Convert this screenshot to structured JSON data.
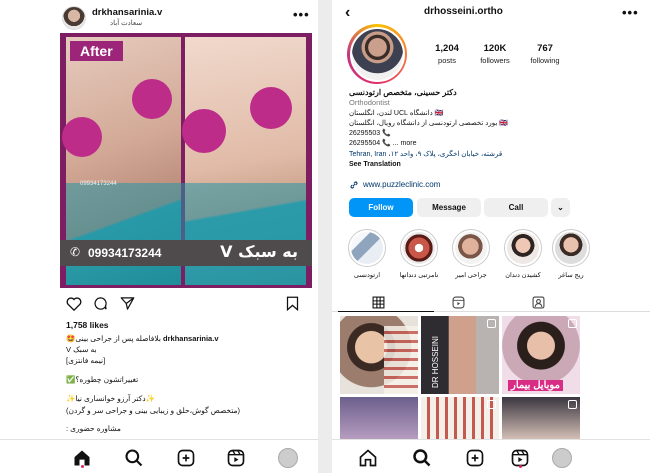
{
  "post": {
    "username": "drkhansarinia.v",
    "subtitle": "سعادت آباد",
    "image": {
      "badge": "After",
      "watermark": "09934173244",
      "phone": "09934173244",
      "style_text": "به سبک V"
    },
    "likes": "1,758 likes",
    "caption_user": "drkhansarinia.v",
    "caption_text": "بلافاصله پس از جراحی بینی🤩",
    "caption_lines": [
      "به سبک V",
      "[نیمه فانتزی]",
      "تغییراتشون چطوره؟✅",
      "✨دکتر آرزو خوانساری نیا✨",
      "(متخصص گوش،حلق و زیبایی بینی و جراحی سر و گردن)",
      "مشاوره حضوری :"
    ]
  },
  "profile": {
    "username": "drhosseini.ortho",
    "stats": [
      {
        "value": "1,204",
        "label": "posts"
      },
      {
        "value": "120K",
        "label": "followers"
      },
      {
        "value": "767",
        "label": "following"
      }
    ],
    "name": "دکتر حسینی، متخصص ارتودنسی",
    "category": "Orthodontist",
    "bio_lines": [
      "🇬🇧 دانشگاه UCL لندن، انگلستان",
      "🇬🇧 بورد تخصصی ارتودنسی از دانشگاه رویال، انگلستان",
      "26295503 📞",
      "26295504 📞 ... more"
    ],
    "address": "Tehran, Iran ،قرشته، خیابان اخگری، پلاک ۹، واحد ۱۲",
    "see_translation": "See Translation",
    "link": "www.puzzleclinic.com",
    "buttons": {
      "follow": "Follow",
      "message": "Message",
      "call": "Call"
    },
    "highlights": [
      "ریج ساغر",
      "کشیدن دندان",
      "جراحی امیر",
      "نامرتبی دندانها",
      "ارتودنسی"
    ],
    "grid_text": "موبایل بیمار",
    "grid_vertical": "DR HOSSEINI"
  },
  "colors": {
    "accent": "#0095f6",
    "post_frame": "#7d1e63",
    "circles": "#bd2c88",
    "badge": "#9d2579"
  }
}
